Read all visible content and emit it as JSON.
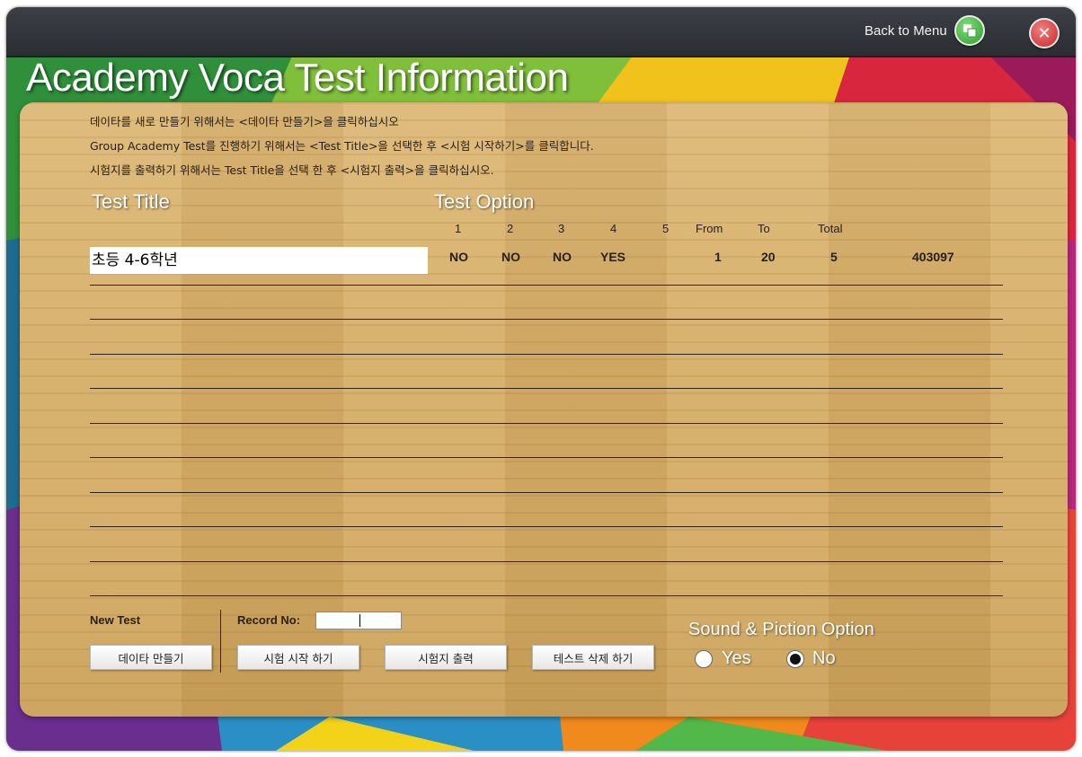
{
  "window": {
    "back_to_menu_label": "Back to Menu",
    "back_icon": "windows-stack-icon",
    "close_icon": "close-x-icon",
    "title": "Academy Voca Test Information"
  },
  "instructions": [
    "데이타를 새로 만들기 위해서는 <데이타 만들기>을 클릭하십시오",
    "Group Academy Test를 진행하기 위해서는 <Test Title>을 선택한 후 <시험 시작하기>를 클릭합니다.",
    "시험지를 출력하기 위해서는 Test Title을 선택 한 후 <시험지 출력>을 클릭하십시오."
  ],
  "table": {
    "title_header": "Test Title",
    "option_header": "Test Option",
    "columns": [
      "1",
      "2",
      "3",
      "4",
      "5",
      "From",
      "To",
      "Total"
    ],
    "rows": [
      {
        "title": "초등 4-6학년",
        "opt1": "NO",
        "opt2": "NO",
        "opt3": "NO",
        "opt4": "YES",
        "opt5": "",
        "from": "1",
        "to": "20",
        "total": "5",
        "record": "403097"
      }
    ]
  },
  "controls": {
    "new_test_label": "New Test",
    "record_no_label": "Record No:",
    "record_no_value": "",
    "buttons": {
      "make_data": "데이타 만들기",
      "start_test": "시험 시작 하기",
      "print_test": "시험지 출력",
      "delete_test": "테스트 삭제 하기"
    },
    "sound_option": {
      "label": "Sound & Piction Option",
      "yes_label": "Yes",
      "no_label": "No",
      "selected": "No"
    }
  }
}
